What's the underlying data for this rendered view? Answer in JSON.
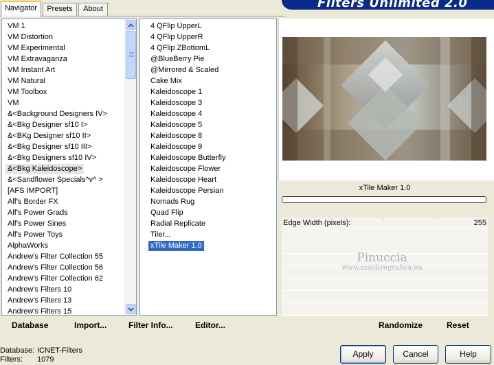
{
  "tabs": [
    {
      "label": "Navigator",
      "active": true
    },
    {
      "label": "Presets",
      "active": false
    },
    {
      "label": "About",
      "active": false
    }
  ],
  "banner": {
    "title": "Filters Unlimited 2.0"
  },
  "categories": [
    {
      "label": "VM 1"
    },
    {
      "label": "VM Distortion"
    },
    {
      "label": "VM Experimental"
    },
    {
      "label": "VM Extravaganza"
    },
    {
      "label": "VM Instant Art"
    },
    {
      "label": "VM Natural"
    },
    {
      "label": "VM Toolbox"
    },
    {
      "label": "VM"
    },
    {
      "label": "&<Background Designers IV>"
    },
    {
      "label": "&<Bkg Designer sf10 I>"
    },
    {
      "label": "&<BKg Designer sf10 II>"
    },
    {
      "label": "&<Bkg Designer sf10 III>"
    },
    {
      "label": "&<Bkg Designers sf10 IV>"
    },
    {
      "label": "&<Bkg Kaleidoscope>",
      "highlighted": true
    },
    {
      "label": "&<Sandflower Specials^v^ >"
    },
    {
      "label": "[AFS IMPORT]"
    },
    {
      "label": "Alf's Border FX"
    },
    {
      "label": "Alf's Power Grads"
    },
    {
      "label": "Alf's Power Sines"
    },
    {
      "label": "Alf's Power Toys"
    },
    {
      "label": "AlphaWorks"
    },
    {
      "label": "Andrew's Filter Collection 55"
    },
    {
      "label": "Andrew's Filter Collection 56"
    },
    {
      "label": "Andrew's Filter Collection 62"
    },
    {
      "label": "Andrew's Filters 10"
    },
    {
      "label": "Andrew's Filters 13"
    },
    {
      "label": "Andrew's Filters 15"
    }
  ],
  "filters": [
    {
      "label": "4 QFlip UpperL"
    },
    {
      "label": "4 QFlip UpperR"
    },
    {
      "label": "4 QFlip ZBottomL"
    },
    {
      "label": "@BlueBerry Pie"
    },
    {
      "label": "@Mirrored & Scaled"
    },
    {
      "label": "Cake Mix"
    },
    {
      "label": "Kaleidoscope 1"
    },
    {
      "label": "Kaleidoscope 3"
    },
    {
      "label": "Kaleidoscope 4"
    },
    {
      "label": "Kaleidoscope 5"
    },
    {
      "label": "Kaleidoscope 8"
    },
    {
      "label": "Kaleidoscope 9"
    },
    {
      "label": "Kaleidoscope Butterfly"
    },
    {
      "label": "Kaleidoscope Flower"
    },
    {
      "label": "Kaleidoscope Heart"
    },
    {
      "label": "Kaleidoscope Persian"
    },
    {
      "label": "Nomads Rug"
    },
    {
      "label": "Quad Flip"
    },
    {
      "label": "Radial Replicate"
    },
    {
      "label": "Tiler..."
    },
    {
      "label": "xTile Maker 1.0",
      "selected": true
    }
  ],
  "preview": {
    "filter_name": "xTile Maker 1.0",
    "progress": 0
  },
  "params": [
    {
      "label": "Edge Width (pixels):",
      "value": "255"
    }
  ],
  "watermark": {
    "line1": "Pinuccia",
    "line2": "www.maidiregrafica.eu"
  },
  "bottom_bar": {
    "database": "Database",
    "import": "Import...",
    "filter_info": "Filter Info...",
    "editor": "Editor...",
    "randomize": "Randomize",
    "reset": "Reset"
  },
  "status": {
    "database_label": "Database:",
    "database_value": "ICNET-Filters",
    "filters_label": "Filters:",
    "filters_value": "1079"
  },
  "dialog_buttons": {
    "apply": "Apply",
    "cancel": "Cancel",
    "help": "Help"
  },
  "colors": {
    "banner": "#0a2a8a",
    "selection": "#316ac5",
    "window_bg": "#ece9d8",
    "tab_accent": "#ffc83c"
  }
}
